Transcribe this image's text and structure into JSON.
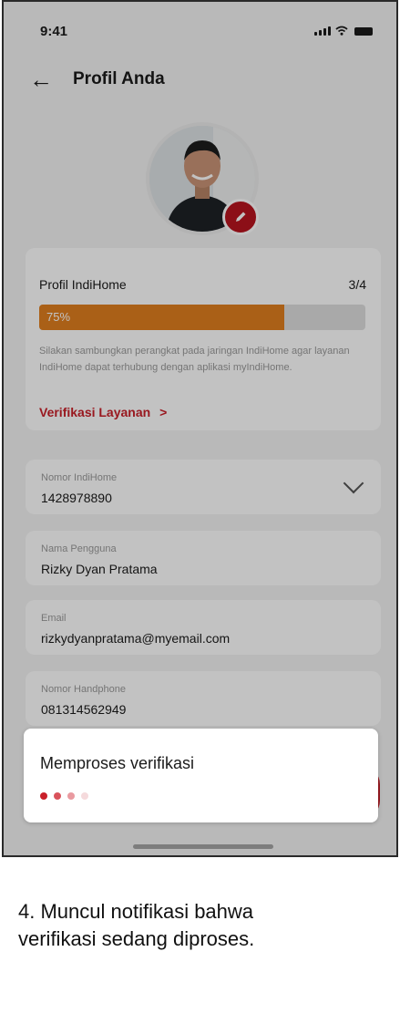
{
  "status_bar": {
    "time": "9:41"
  },
  "header": {
    "title": "Profil Anda"
  },
  "profile_card": {
    "title": "Profil IndiHome",
    "count": "3/4",
    "progress_label": "75%",
    "progress_fraction": 0.75,
    "description": "Silakan sambungkan perangkat pada jaringan IndiHome agar layanan IndiHome dapat terhubung dengan aplikasi myIndiHome.",
    "link_label": "Verifikasi Layanan",
    "link_chevron": ">"
  },
  "fields": {
    "indihome_number": {
      "label": "Nomor IndiHome",
      "value": "1428978890"
    },
    "username": {
      "label": "Nama Pengguna",
      "value": "Rizky Dyan Pratama"
    },
    "email": {
      "label": "Email",
      "value": "rizkydyanpratama@myemail.com"
    },
    "phone": {
      "label": "Nomor Handphone",
      "value": "081314562949"
    }
  },
  "toast": {
    "text": "Memproses verifikasi"
  },
  "caption": {
    "line1": "4. Muncul notifikasi bahwa",
    "line2": "verifikasi sedang diproses."
  },
  "icons": {
    "back": "arrow-left",
    "edit": "pencil",
    "dropdown": "chevron-down",
    "signal": "signal-bars",
    "wifi": "wifi",
    "battery": "battery"
  },
  "colors": {
    "accent_red": "#c9202a",
    "progress_orange": "#e07f1f",
    "dot_colors": [
      "#c9202a",
      "#d9535b",
      "#e99aa0",
      "#f5dadc"
    ]
  }
}
